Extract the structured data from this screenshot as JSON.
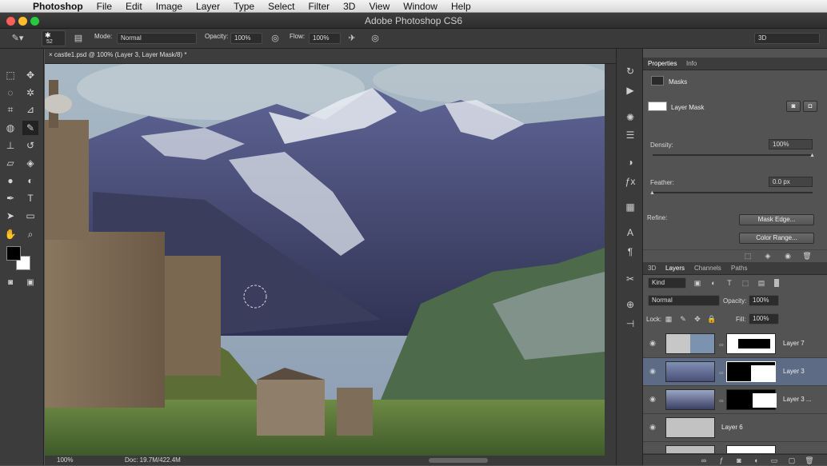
{
  "menubar": {
    "app": "Photoshop",
    "items": [
      "File",
      "Edit",
      "Image",
      "Layer",
      "Type",
      "Select",
      "Filter",
      "3D",
      "View",
      "Window",
      "Help"
    ]
  },
  "window": {
    "title": "Adobe Photoshop CS6"
  },
  "options": {
    "brush_size": "52",
    "mode_label": "Mode:",
    "mode_value": "Normal",
    "opacity_label": "Opacity:",
    "opacity_value": "100%",
    "flow_label": "Flow:",
    "flow_value": "100%",
    "workspace": "3D"
  },
  "document": {
    "tab_title": "castle1.psd @ 100% (Layer 3, Layer Mask/8) *"
  },
  "status": {
    "zoom": "100%",
    "doc": "Doc: 19.7M/422.4M"
  },
  "properties": {
    "tabs": [
      "Properties",
      "Info"
    ],
    "section": "Masks",
    "mask_type": "Layer Mask",
    "density_label": "Density:",
    "density_value": "100%",
    "density_level": 1.0,
    "feather_label": "Feather:",
    "feather_value": "0.0 px",
    "feather_level": 0.0,
    "refine_label": "Refine:",
    "mask_edge_btn": "Mask Edge...",
    "color_range_btn": "Color Range..."
  },
  "layers_panel": {
    "tabs": [
      "3D",
      "Layers",
      "Channels",
      "Paths"
    ],
    "filter_kind": "Kind",
    "blend_mode": "Normal",
    "opacity_label": "Opacity:",
    "opacity_value": "100%",
    "lock_label": "Lock:",
    "fill_label": "Fill:",
    "fill_value": "100%",
    "layers": [
      {
        "name": "Layer 7",
        "selected": false
      },
      {
        "name": "Layer 3",
        "selected": true
      },
      {
        "name": "Layer 3 ...",
        "selected": false
      },
      {
        "name": "Layer 6",
        "selected": false
      }
    ]
  },
  "colors": {
    "accent": "#5d6b85",
    "panel": "#535353",
    "dark": "#3c3c3c"
  }
}
